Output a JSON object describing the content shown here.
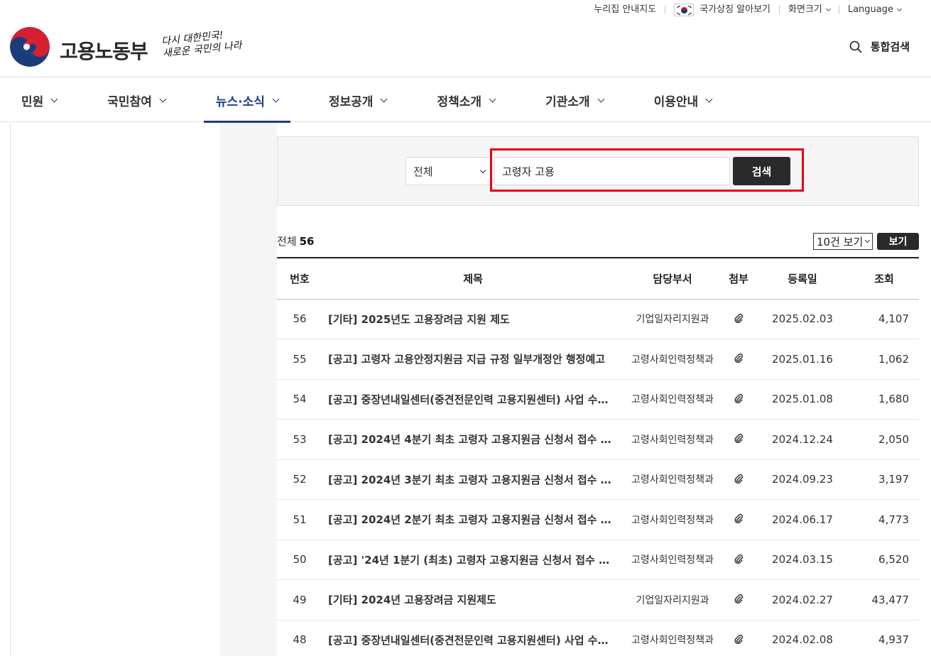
{
  "utility": {
    "sitemap": "누리집 안내지도",
    "national_symbols": "국가상징 알아보기",
    "screen_size": "화면크기",
    "language": "Language"
  },
  "header": {
    "ministry_name": "고용노동부",
    "slogan_line1": "다시 대한민국!",
    "slogan_line2": "새로운 국민의 나라",
    "total_search": "통합검색"
  },
  "nav": {
    "items": [
      {
        "label": "민원"
      },
      {
        "label": "국민참여"
      },
      {
        "label": "뉴스·소식",
        "active": true
      },
      {
        "label": "정보공개"
      },
      {
        "label": "정책소개"
      },
      {
        "label": "기관소개"
      },
      {
        "label": "이용안내"
      }
    ]
  },
  "search": {
    "category": "전체",
    "query": "고령자 고용",
    "button": "검색"
  },
  "list": {
    "total_label": "전체",
    "total_count": "56",
    "per_page": "10건 보기",
    "view_button": "보기",
    "columns": [
      "번호",
      "제목",
      "담당부서",
      "첨부",
      "등록일",
      "조회"
    ],
    "rows": [
      {
        "no": "56",
        "title": "[기타] 2025년도 고용장려금 지원 제도",
        "dept": "기업일자리지원과",
        "date": "2025.02.03",
        "views": "4,107"
      },
      {
        "no": "55",
        "title": "[공고] 고령자 고용안정지원금 지급 규정 일부개정안 행정예고",
        "dept": "고령사회인력정책과",
        "date": "2025.01.16",
        "views": "1,062"
      },
      {
        "no": "54",
        "title": "[공고] 중장년내일센터(중견전문인력 고용지원센터) 사업 수…",
        "dept": "고령사회인력정책과",
        "date": "2025.01.08",
        "views": "1,680"
      },
      {
        "no": "53",
        "title": "[공고] 2024년 4분기 최초 고령자 고용지원금 신청서 접수 …",
        "dept": "고령사회인력정책과",
        "date": "2024.12.24",
        "views": "2,050"
      },
      {
        "no": "52",
        "title": "[공고] 2024년 3분기 최초 고령자 고용지원금 신청서 접수 …",
        "dept": "고령사회인력정책과",
        "date": "2024.09.23",
        "views": "3,197"
      },
      {
        "no": "51",
        "title": "[공고] 2024년 2분기 최초 고령자 고용지원금 신청서 접수 …",
        "dept": "고령사회인력정책과",
        "date": "2024.06.17",
        "views": "4,773"
      },
      {
        "no": "50",
        "title": "[공고] '24년 1분기 (최초) 고령자 고용지원금 신청서 접수 …",
        "dept": "고령사회인력정책과",
        "date": "2024.03.15",
        "views": "6,520"
      },
      {
        "no": "49",
        "title": "[기타] 2024년 고용장려금 지원제도",
        "dept": "기업일자리지원과",
        "date": "2024.02.27",
        "views": "43,477"
      },
      {
        "no": "48",
        "title": "[공고] 중장년내일센터(중견전문인력 고용지원센터) 사업 수…",
        "dept": "고령사회인력정책과",
        "date": "2024.02.08",
        "views": "4,937"
      }
    ]
  },
  "colors": {
    "accent": "#1f3c88",
    "highlight": "#e60012",
    "button_dark": "#2a2a2a"
  }
}
